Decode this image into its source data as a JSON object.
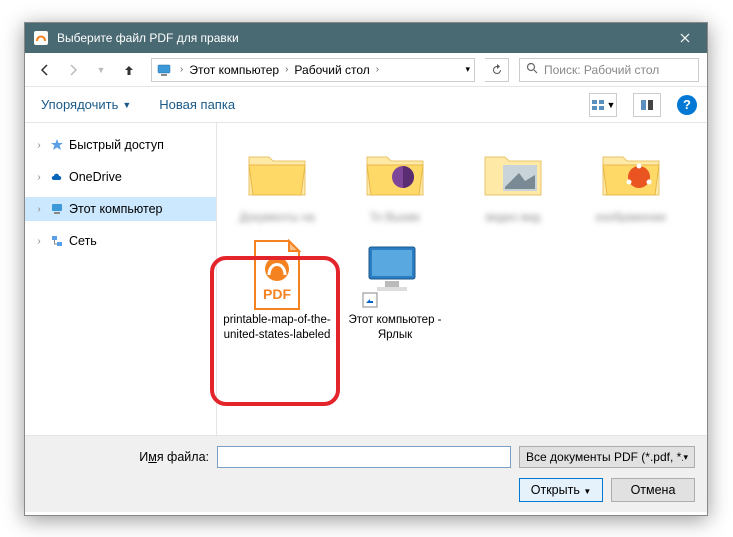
{
  "titlebar": {
    "title": "Выберите файл PDF для правки"
  },
  "breadcrumbs": {
    "root": "Этот компьютер",
    "folder": "Рабочий стол"
  },
  "search": {
    "placeholder": "Поиск: Рабочий стол"
  },
  "toolbar": {
    "organize": "Упорядочить",
    "newfolder": "Новая папка"
  },
  "sidebar": {
    "items": [
      {
        "label": "Быстрый доступ"
      },
      {
        "label": "OneDrive"
      },
      {
        "label": "Этот компьютер"
      },
      {
        "label": "Сеть"
      }
    ]
  },
  "files": {
    "blurred": [
      "Документы на",
      "То Вьюве",
      "видео вид",
      "изображение"
    ],
    "pdf_label": "printable-map-of-the-united-states-labeled",
    "pdf_badge": "PDF",
    "shortcut_label": "Этот компьютер - Ярлык"
  },
  "bottom": {
    "filename_label_pre": "И",
    "filename_label_u": "м",
    "filename_label_post": "я файла:",
    "filename_value": "",
    "filter": "Все документы PDF (*.pdf, *.pс",
    "open": "Открыть",
    "cancel": "Отмена"
  }
}
